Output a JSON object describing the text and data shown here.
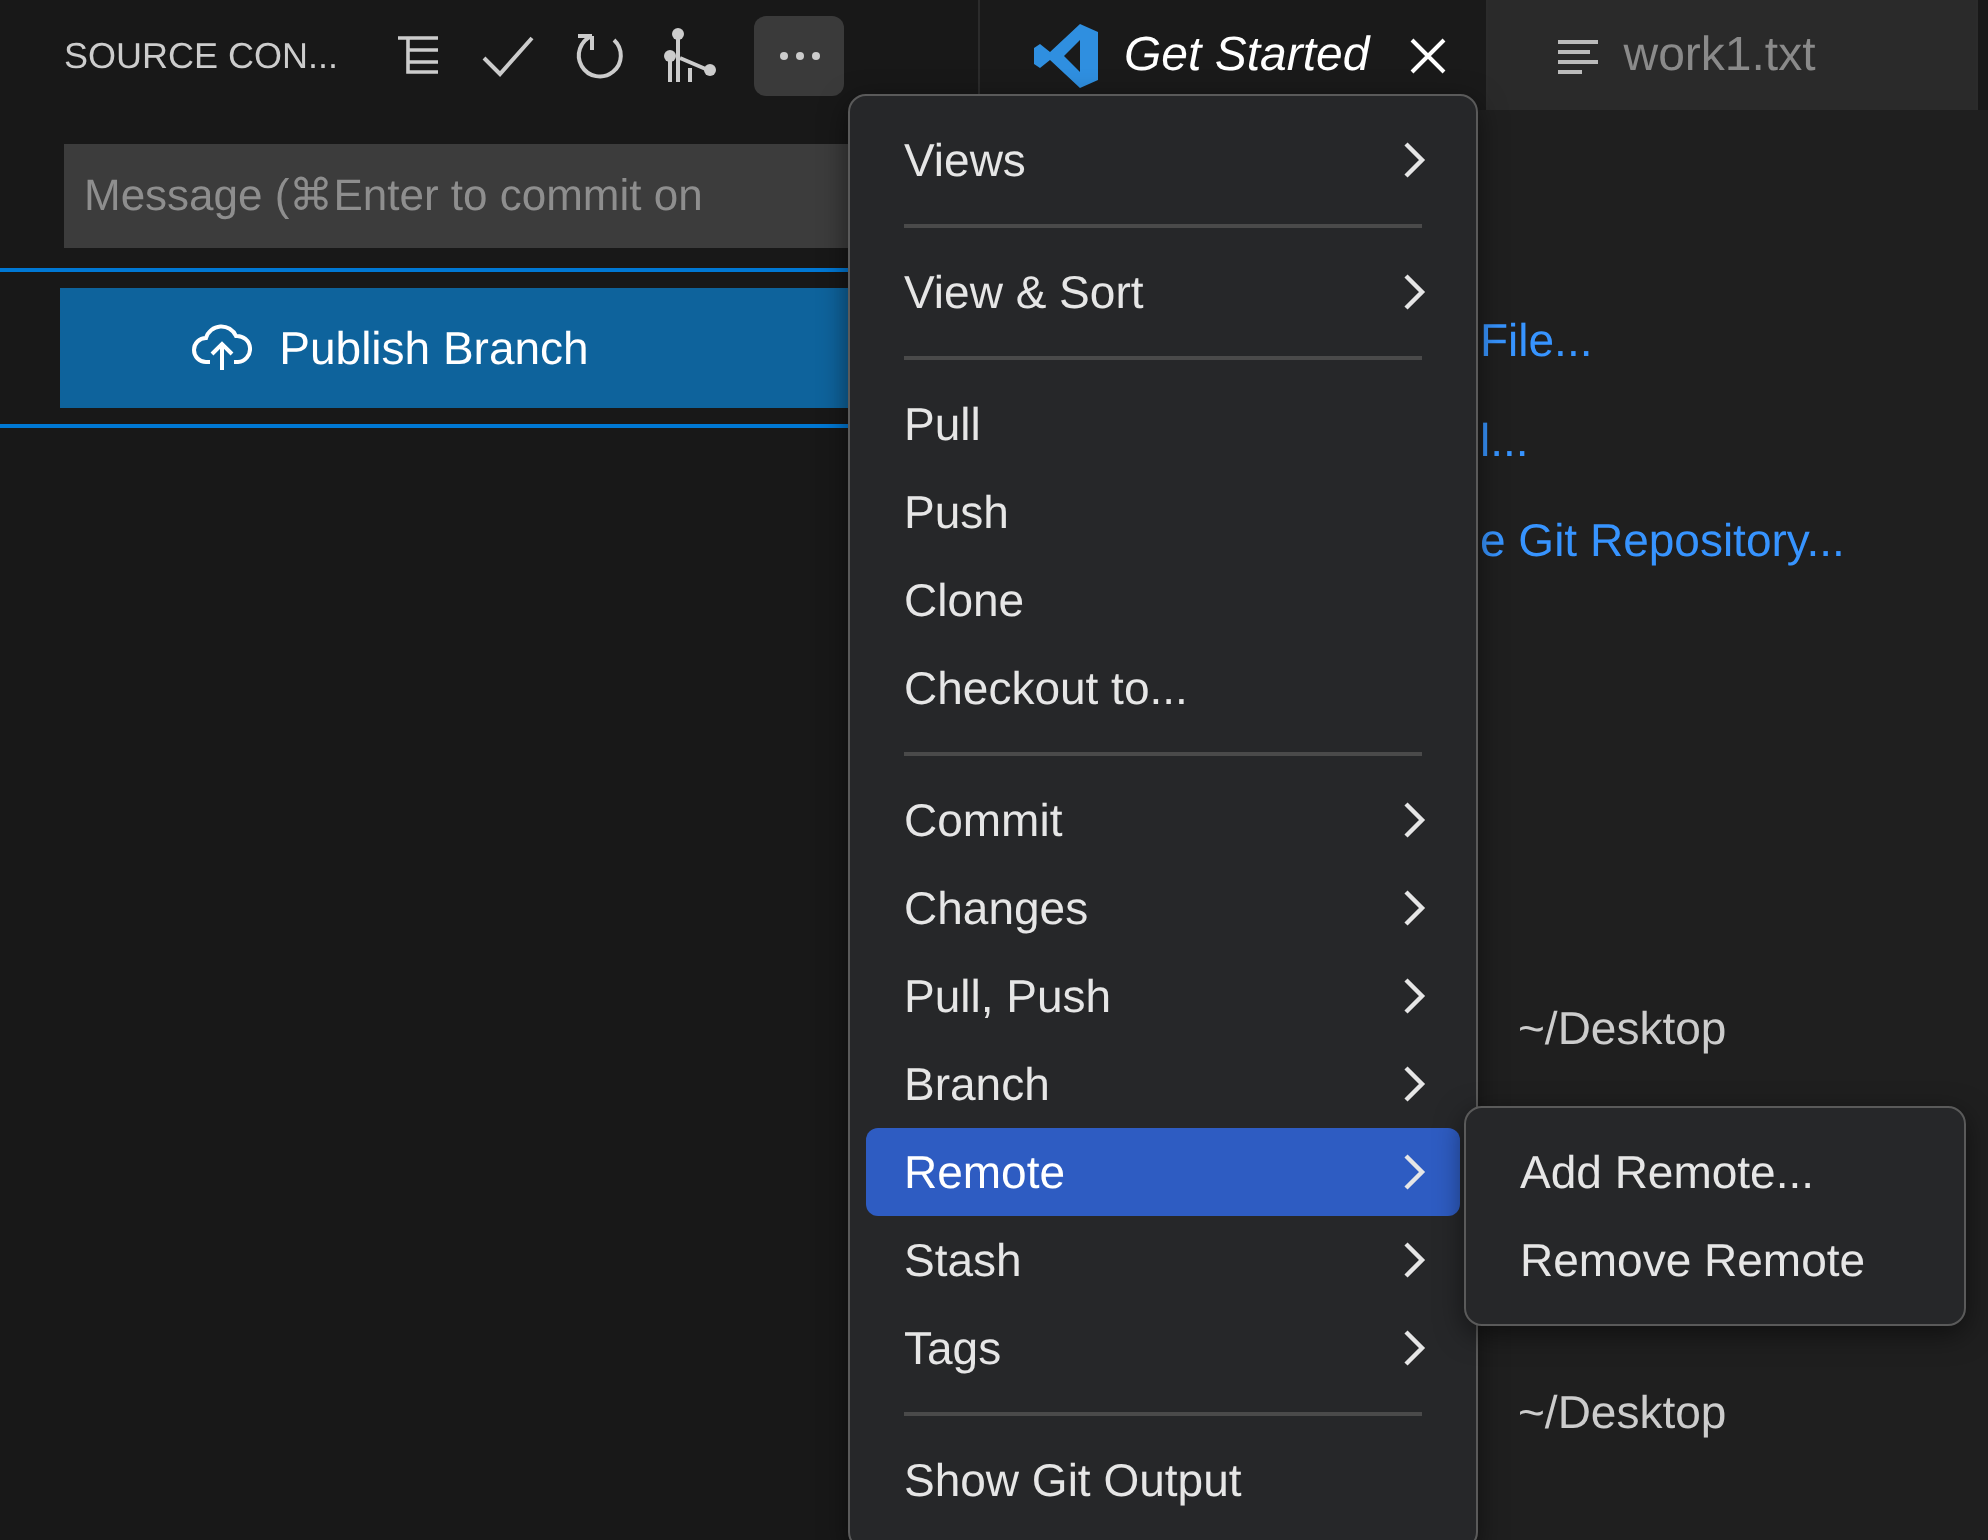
{
  "sidebar": {
    "title": "SOURCE CON...",
    "more_button": {
      "active": true
    },
    "commit_message": {
      "placeholder": "Message (⌘Enter to commit on"
    },
    "publish_button": {
      "label": "Publish Branch"
    }
  },
  "tabs": [
    {
      "label": "Get Started",
      "kind": "welcome",
      "selected": true
    },
    {
      "label": "work1.txt",
      "kind": "file",
      "selected": false
    }
  ],
  "editor": {
    "links": [
      "File...",
      "l...",
      "e Git Repository..."
    ],
    "recent": [
      "~/Desktop",
      "~/Desktop"
    ]
  },
  "menu": {
    "items": [
      {
        "kind": "item",
        "label": "Views",
        "submenu": true,
        "selected": false
      },
      {
        "kind": "separator"
      },
      {
        "kind": "item",
        "label": "View & Sort",
        "submenu": true,
        "selected": false
      },
      {
        "kind": "separator"
      },
      {
        "kind": "item",
        "label": "Pull",
        "submenu": false,
        "selected": false
      },
      {
        "kind": "item",
        "label": "Push",
        "submenu": false,
        "selected": false
      },
      {
        "kind": "item",
        "label": "Clone",
        "submenu": false,
        "selected": false
      },
      {
        "kind": "item",
        "label": "Checkout to...",
        "submenu": false,
        "selected": false
      },
      {
        "kind": "separator"
      },
      {
        "kind": "item",
        "label": "Commit",
        "submenu": true,
        "selected": false
      },
      {
        "kind": "item",
        "label": "Changes",
        "submenu": true,
        "selected": false
      },
      {
        "kind": "item",
        "label": "Pull, Push",
        "submenu": true,
        "selected": false
      },
      {
        "kind": "item",
        "label": "Branch",
        "submenu": true,
        "selected": false
      },
      {
        "kind": "item",
        "label": "Remote",
        "submenu": true,
        "selected": true
      },
      {
        "kind": "item",
        "label": "Stash",
        "submenu": true,
        "selected": false
      },
      {
        "kind": "item",
        "label": "Tags",
        "submenu": true,
        "selected": false
      },
      {
        "kind": "separator"
      },
      {
        "kind": "item",
        "label": "Show Git Output",
        "submenu": false,
        "selected": false
      }
    ]
  },
  "submenu": {
    "items": [
      {
        "kind": "item",
        "label": "Add Remote...",
        "submenu": false,
        "selected": false
      },
      {
        "kind": "item",
        "label": "Remove Remote",
        "submenu": false,
        "selected": false
      }
    ]
  }
}
